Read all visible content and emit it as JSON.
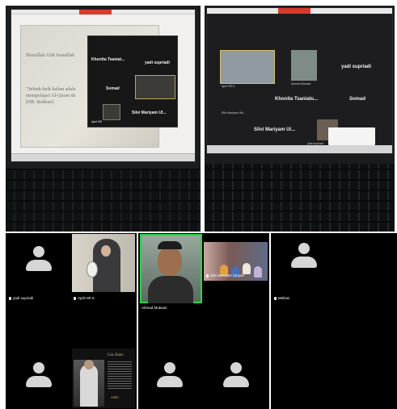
{
  "top_left_photo": {
    "slide_lines": [
      "Bismillah ASR bismillah",
      "\"Sebaik-baik kalian adala",
      "mempelajari Al-Quran da",
      "(HR. Bukhari)"
    ],
    "panel_names": [
      "Khonita Tsaniat...",
      "yadi supriadi",
      "Somad",
      "Silvi Mariyam Ul..."
    ],
    "small_labels": [
      "April HR"
    ]
  },
  "top_right_photo": {
    "names": [
      "yadi supriadi",
      "Khonita Tsaniatu...",
      "Somad",
      "Silvi Mariyam Ul..."
    ],
    "small_labels": [
      "April HR 6",
      "Ahmad Mubasir",
      "Silvi Mariyam Uhl...",
      "yadi supriadi"
    ]
  },
  "zoom_shots": [
    {
      "tiles": [
        {
          "name": "yadi supriadi"
        },
        {
          "name": "April HR 6"
        }
      ],
      "poster": {
        "title": "Gus Baha",
        "signature": "ASRO"
      }
    },
    {
      "tiles": [
        {
          "name": "Ahmad Mubasir"
        },
        {
          "name": "Silvi Mariyam Ulnyah"
        }
      ]
    },
    {
      "tiles": [
        {
          "name": "Meliani"
        }
      ]
    }
  ],
  "colors": {
    "active_speaker": "#29d34f",
    "zoom_bg": "#000000",
    "avatar": "#d6d6d6"
  }
}
